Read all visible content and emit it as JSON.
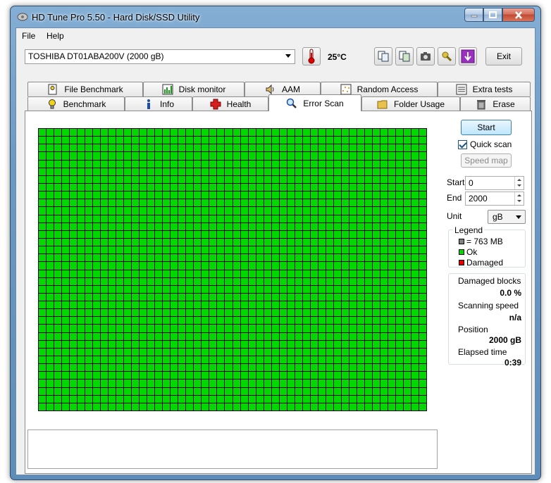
{
  "window": {
    "title": "HD Tune Pro 5.50 - Hard Disk/SSD Utility"
  },
  "menu": {
    "file": "File",
    "help": "Help"
  },
  "toolbar": {
    "drive": "TOSHIBA DT01ABA200V (2000 gB)",
    "temperature": "25°C",
    "exit_label": "Exit"
  },
  "tabs_top": [
    "File Benchmark",
    "Disk monitor",
    "AAM",
    "Random Access",
    "Extra tests"
  ],
  "tabs_bottom": [
    "Benchmark",
    "Info",
    "Health",
    "Error Scan",
    "Folder Usage",
    "Erase"
  ],
  "active_tab": "Error Scan",
  "scan": {
    "start_label": "Start",
    "quick_scan_label": "Quick scan",
    "quick_scan_checked": true,
    "speed_map_label": "Speed map",
    "start_field_label": "Start",
    "start_value": "0",
    "end_field_label": "End",
    "end_value": "2000",
    "unit_label": "Unit",
    "unit_value": "gB"
  },
  "legend": {
    "title": "Legend",
    "block_size": "= 763 MB",
    "ok": "Ok",
    "damaged": "Damaged",
    "colors": {
      "block": "#808080",
      "ok": "#00d800",
      "damaged": "#e00000"
    }
  },
  "stats": {
    "damaged_blocks_label": "Damaged blocks",
    "damaged_blocks_value": "0.0 %",
    "scanning_speed_label": "Scanning speed",
    "scanning_speed_value": "n/a",
    "position_label": "Position",
    "position_value": "2000 gB",
    "elapsed_label": "Elapsed time",
    "elapsed_value": "0:39"
  },
  "block_map": {
    "columns": 50,
    "rows": 36,
    "status": "ok"
  }
}
